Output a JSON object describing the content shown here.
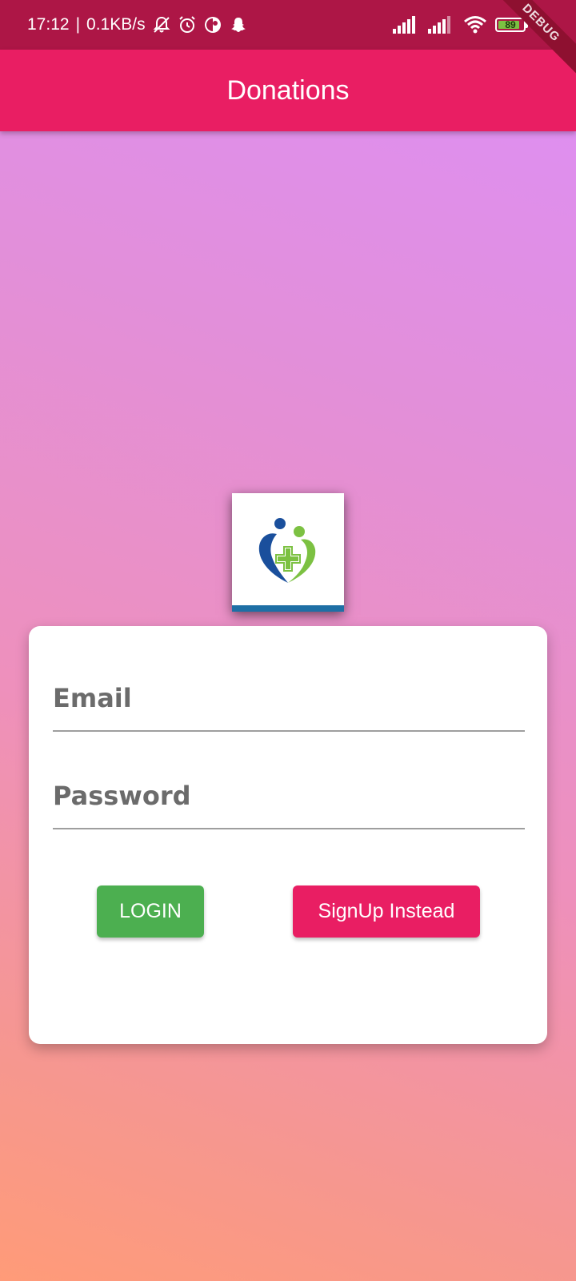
{
  "status_bar": {
    "time": "17:12",
    "separator": "|",
    "net_speed": "0.1KB/s",
    "battery": "89",
    "battery_level": 0.89,
    "icons": [
      "bell-off-icon",
      "alarm-icon",
      "app-icon",
      "snapchat-icon",
      "signal-icon",
      "signal-icon",
      "wifi-icon",
      "battery-icon"
    ]
  },
  "debug_banner": "DEBUG",
  "app_bar": {
    "title": "Donations"
  },
  "logo": {
    "icon": "heart-medical-cross-logo",
    "colors": {
      "blue": "#1A4F9C",
      "green": "#7CC142",
      "strip": "#1E6FA5"
    }
  },
  "login_form": {
    "email_placeholder": "Email",
    "password_placeholder": "Password",
    "login_label": "LOGIN",
    "signup_label": "SignUp Instead"
  },
  "colors": {
    "status_bar": "#AD1646",
    "app_bar": "#E91E63",
    "login_button": "#4CAF50",
    "signup_button": "#E91E63",
    "gradient_top": "#DD8FF8",
    "gradient_bottom": "#FF9B78"
  }
}
